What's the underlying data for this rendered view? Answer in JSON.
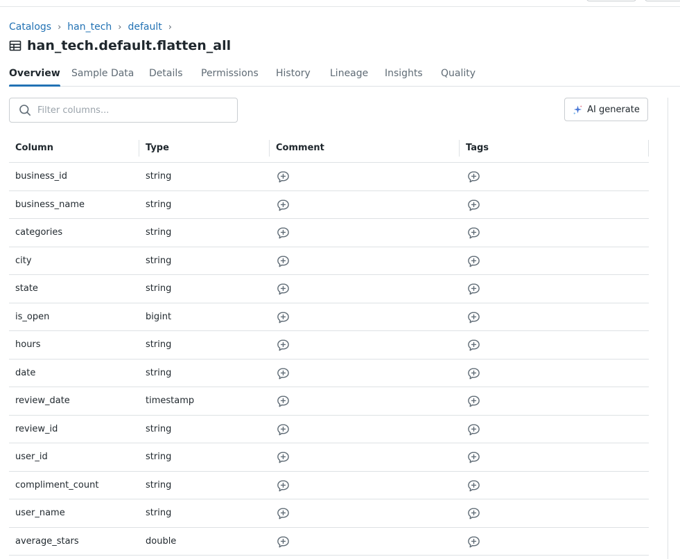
{
  "breadcrumb": {
    "items": [
      "Catalogs",
      "han_tech",
      "default"
    ],
    "separator": "›"
  },
  "page": {
    "title": "han_tech.default.flatten_all"
  },
  "tabs": [
    {
      "label": "Overview",
      "active": true
    },
    {
      "label": "Sample Data",
      "active": false
    },
    {
      "label": "Details",
      "active": false
    },
    {
      "label": "Permissions",
      "active": false
    },
    {
      "label": "History",
      "active": false
    },
    {
      "label": "Lineage",
      "active": false
    },
    {
      "label": "Insights",
      "active": false
    },
    {
      "label": "Quality",
      "active": false
    }
  ],
  "filter": {
    "placeholder": "Filter columns...",
    "value": ""
  },
  "ai_button": {
    "label": "AI generate"
  },
  "table": {
    "headers": [
      "Column",
      "Type",
      "Comment",
      "Tags"
    ],
    "rows": [
      {
        "name": "business_id",
        "type": "string"
      },
      {
        "name": "business_name",
        "type": "string"
      },
      {
        "name": "categories",
        "type": "string"
      },
      {
        "name": "city",
        "type": "string"
      },
      {
        "name": "state",
        "type": "string"
      },
      {
        "name": "is_open",
        "type": "bigint"
      },
      {
        "name": "hours",
        "type": "string"
      },
      {
        "name": "date",
        "type": "string"
      },
      {
        "name": "review_date",
        "type": "timestamp"
      },
      {
        "name": "review_id",
        "type": "string"
      },
      {
        "name": "user_id",
        "type": "string"
      },
      {
        "name": "compliment_count",
        "type": "string"
      },
      {
        "name": "user_name",
        "type": "string"
      },
      {
        "name": "average_stars",
        "type": "double"
      }
    ]
  },
  "icons": {
    "table": "table-icon",
    "search": "search-icon",
    "sparkle": "sparkle-icon",
    "comment": "add-comment-icon",
    "tag": "add-tag-icon"
  },
  "colors": {
    "link": "#2272b4",
    "active_tab_underline": "#2272b4",
    "text": "#1f272d",
    "muted": "#5f6b75",
    "border": "#dde1e4"
  }
}
